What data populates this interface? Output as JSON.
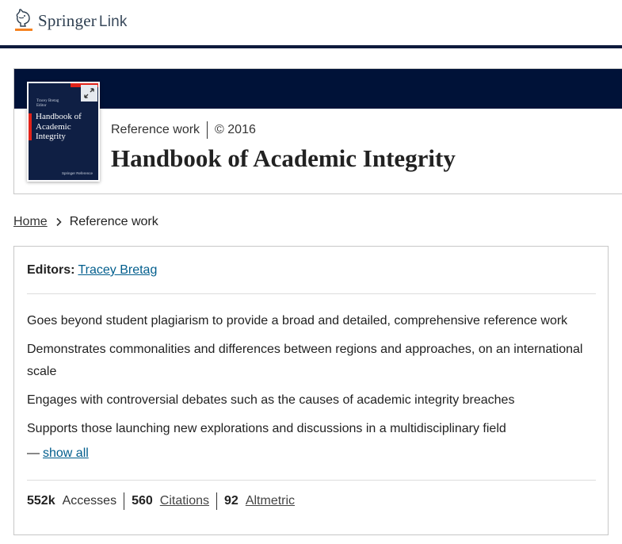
{
  "header": {
    "logo_brand": "Springer",
    "logo_suffix": "Link"
  },
  "hero": {
    "content_type": "Reference work",
    "year": "© 2016",
    "title": "Handbook of Academic Integrity",
    "cover": {
      "author": "Tracey Bretag",
      "role": "Editor",
      "title": "Handbook of Academic Integrity",
      "publisher": "Springer Reference"
    },
    "expand_icon": "expand-arrows-icon"
  },
  "breadcrumb": {
    "home": "Home",
    "current": "Reference work",
    "separator_icon": "chevron-right-icon"
  },
  "card": {
    "editors_label": "Editors:",
    "editor_name": "Tracey Bretag",
    "features": [
      "Goes beyond student plagiarism to provide a broad and detailed, comprehensive reference work",
      "Demonstrates commonalities and differences between regions and approaches, on an international scale",
      "Engages with controversial debates such as the causes of academic integrity breaches",
      "Supports those launching new explorations and discussions in a multidisciplinary field"
    ],
    "show_all_prefix": "—",
    "show_all_label": "show all",
    "metrics": {
      "accesses_value": "552k",
      "accesses_label": "Accesses",
      "citations_value": "560",
      "citations_label": "Citations",
      "altmetric_value": "92",
      "altmetric_label": "Altmetric"
    }
  },
  "colors": {
    "navy": "#001238",
    "accent_red": "#e2231a",
    "link_blue": "#025e8d"
  }
}
